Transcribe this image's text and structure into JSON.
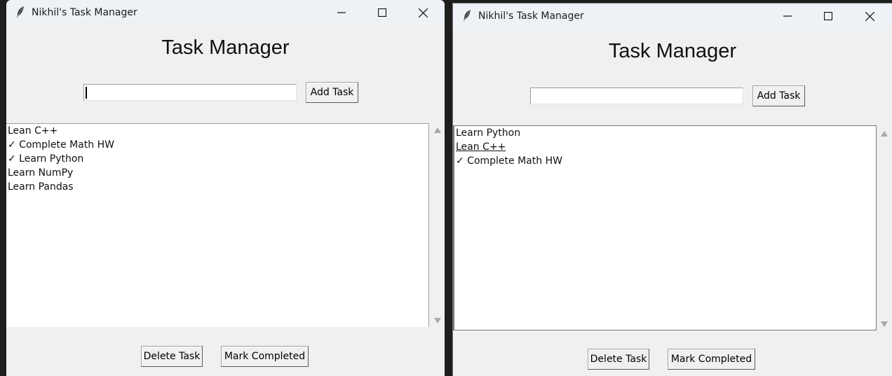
{
  "windows": [
    {
      "title": "Nikhil's Task Manager",
      "heading": "Task Manager",
      "input": {
        "value": ""
      },
      "add_label": "Add Task",
      "tasks": [
        "Lean C++",
        "✓ Complete Math HW",
        "✓ Learn Python",
        "Learn NumPy",
        "Learn Pandas"
      ],
      "active_task": "",
      "delete_label": "Delete Task",
      "complete_label": "Mark Completed"
    },
    {
      "title": "Nikhil's Task Manager",
      "heading": "Task Manager",
      "input": {
        "value": ""
      },
      "add_label": "Add Task",
      "tasks": [
        "Learn Python",
        "Lean C++",
        "✓ Complete Math HW"
      ],
      "active_task": "Lean C++",
      "delete_label": "Delete Task",
      "complete_label": "Mark Completed"
    }
  ],
  "icons": {
    "app": "feather-icon",
    "minimize": "minimize-icon",
    "maximize": "maximize-icon",
    "close": "close-icon",
    "scroll_up": "arrow-up-icon",
    "scroll_down": "arrow-down-icon"
  }
}
